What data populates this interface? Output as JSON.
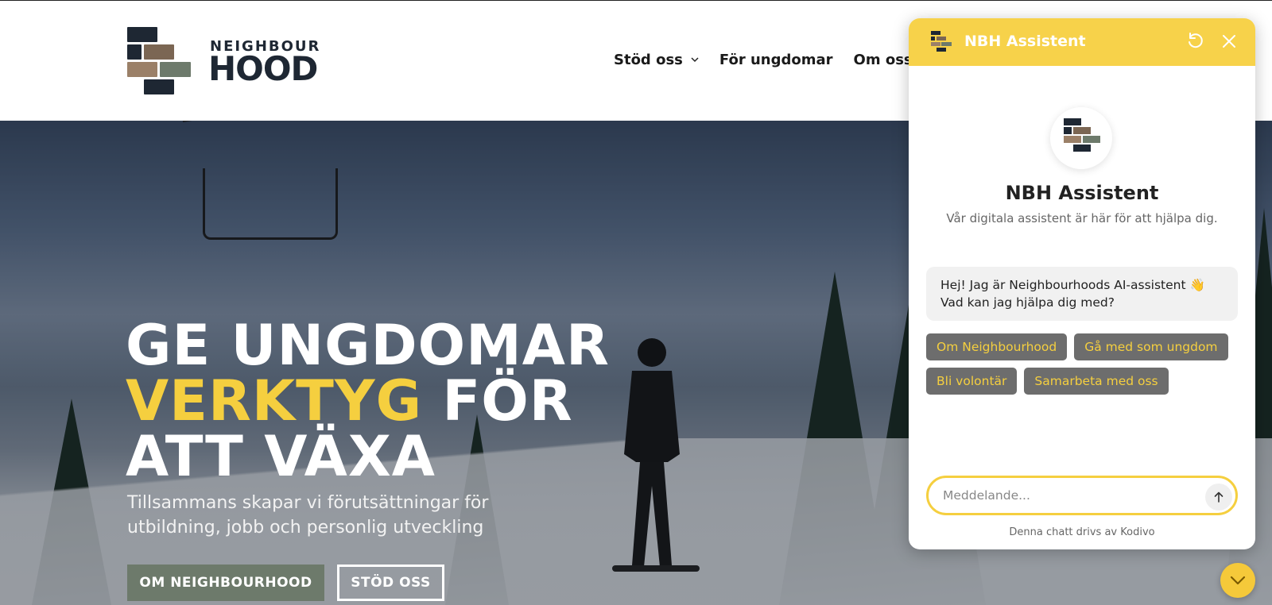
{
  "brand": {
    "logo_top": "NEIGHBOUR",
    "logo_bottom": "HOOD",
    "colors": {
      "dark": "#1e2733",
      "brown": "#7b6653",
      "tan": "#9b8068",
      "green": "#6d7a6b",
      "accent_yellow": "#f5cf3f"
    }
  },
  "nav": {
    "items": [
      {
        "label": "Stöd oss",
        "has_dropdown": true
      },
      {
        "label": "För ungdomar",
        "has_dropdown": false
      },
      {
        "label": "Om oss",
        "has_dropdown": true
      }
    ],
    "dropdown_icon": "chevron-down-icon"
  },
  "hero": {
    "title_line1": "GE UNGDOMAR",
    "title_accent": "VERKTYG",
    "title_line2_rest": " FÖR",
    "title_line3": "ATT VÄXA",
    "subtitle": "Tillsammans skapar vi förutsättningar för utbildning, jobb och personlig utveckling",
    "primary_button": "OM NEIGHBOURHOOD",
    "secondary_button": "STÖD OSS"
  },
  "chat": {
    "header_title": "NBH Assistent",
    "header_color": "#f7d24a",
    "reset_icon": "refresh-icon",
    "close_icon": "close-icon",
    "assistant_name": "NBH Assistent",
    "assistant_description": "Vår digitala assistent är här för att hjälpa dig.",
    "greeting_line1": "Hej! Jag är Neighbourhoods AI-assistent 👋",
    "greeting_line2": "Vad kan jag hjälpa dig med?",
    "suggestions": [
      "Om Neighbourhood",
      "Gå med som ungdom",
      "Bli volontär",
      "Samarbeta med oss"
    ],
    "input_placeholder": "Meddelande...",
    "input_value": "",
    "send_icon": "arrow-up-icon",
    "powered_by": "Denna chatt drivs av Kodivo"
  },
  "launcher": {
    "icon": "chevron-down-icon",
    "color": "#f5c93a"
  }
}
